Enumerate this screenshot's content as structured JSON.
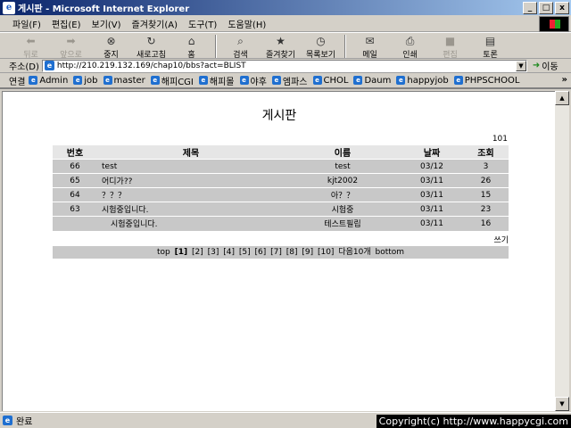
{
  "window": {
    "title": "게시판 - Microsoft Internet Explorer",
    "minimize": "_",
    "maximize": "□",
    "close": "x"
  },
  "menubar": [
    "파일(F)",
    "편집(E)",
    "보기(V)",
    "즐겨찾기(A)",
    "도구(T)",
    "도움말(H)"
  ],
  "toolbar": {
    "back": "뒤로",
    "forward": "앞으로",
    "stop": "중지",
    "refresh": "새로고침",
    "home": "홈",
    "search": "검색",
    "favorites": "즐겨찾기",
    "history": "목록보기",
    "mail": "메일",
    "print": "인쇄",
    "edit": "편집",
    "discuss": "토론"
  },
  "addressbar": {
    "label": "주소(D)",
    "url": "http://210.219.132.169/chap10/bbs?act=BLIST",
    "go": "이동"
  },
  "linksbar": {
    "label": "연결",
    "links": [
      "Admin",
      "job",
      "master",
      "해피CGI",
      "해피몰",
      "야후",
      "엠파스",
      "CHOL",
      "Daum",
      "happyjob",
      "PHPSCHOOL"
    ],
    "more": "»"
  },
  "page": {
    "title": "게시판",
    "total_count": "101",
    "columns": [
      "번호",
      "제목",
      "이름",
      "날짜",
      "조회"
    ],
    "rows": [
      {
        "num": "66",
        "title": "test",
        "name": "test",
        "date": "03/12",
        "views": "3"
      },
      {
        "num": "65",
        "title": "어디가??",
        "name": "kjt2002",
        "date": "03/11",
        "views": "26"
      },
      {
        "num": "64",
        "title": "？？？",
        "name": "아？？",
        "date": "03/11",
        "views": "15"
      },
      {
        "num": "63",
        "title": "시험중입니다.",
        "name": "시험중",
        "date": "03/11",
        "views": "23"
      },
      {
        "num": "",
        "title": "시험중입니다.",
        "name": "테스트필립",
        "date": "03/11",
        "views": "16"
      }
    ],
    "write_link": "쓰기",
    "pager": {
      "top": "top",
      "pages": [
        "[1]",
        "[2]",
        "[3]",
        "[4]",
        "[5]",
        "[6]",
        "[7]",
        "[8]",
        "[9]",
        "[10]"
      ],
      "next": "다음10개",
      "bottom": "bottom"
    }
  },
  "statusbar": {
    "text": "완료"
  },
  "copyright": "Copyright(c) http://www.happycgi.com"
}
